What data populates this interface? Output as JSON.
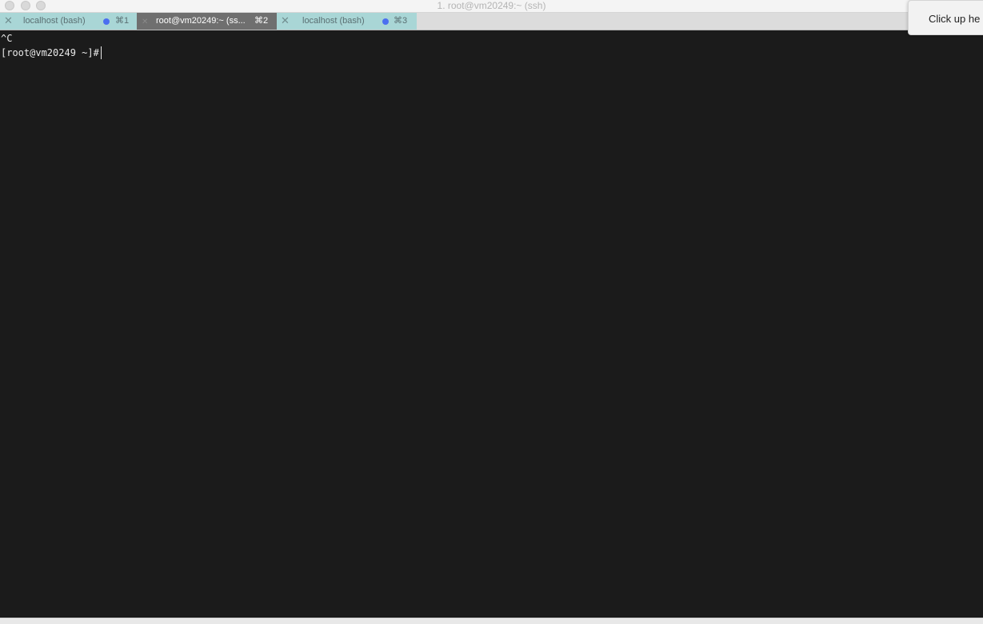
{
  "window": {
    "title": "1. root@vm20249:~ (ssh)"
  },
  "tabs": [
    {
      "label": "localhost (bash)",
      "close": "✕",
      "shortcut": "⌘1",
      "active": false
    },
    {
      "label": "root@vm20249:~ (ss...",
      "close": "✕",
      "shortcut": "⌘2",
      "active": true
    },
    {
      "label": "localhost (bash)",
      "close": "✕",
      "shortcut": "⌘3",
      "active": false
    }
  ],
  "terminal": {
    "lines": [
      "^C",
      "[root@vm20249 ~]#"
    ]
  },
  "notification": {
    "text": "Click up he"
  },
  "colors": {
    "terminal_bg": "#1b1b1b",
    "tab_inactive": "#a9d6d6",
    "tab_active": "#6f6f6f",
    "activity_dot": "#4b6ff0"
  }
}
